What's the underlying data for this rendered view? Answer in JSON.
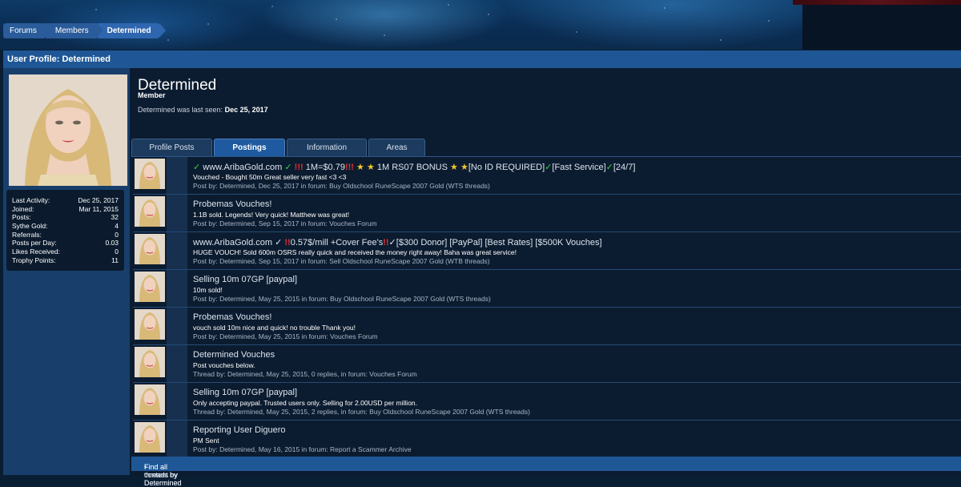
{
  "breadcrumb": [
    "Forums",
    "Members",
    "Determined"
  ],
  "header": {
    "title": "User Profile: Determined"
  },
  "profile": {
    "username": "Determined",
    "role": "Member",
    "last_seen_label": "Determined was last seen:",
    "last_seen_value": "Dec 25, 2017"
  },
  "stats": [
    {
      "label": "Last Activity:",
      "value": "Dec 25, 2017"
    },
    {
      "label": "Joined:",
      "value": "Mar 11, 2015"
    },
    {
      "label": "Posts:",
      "value": "32"
    },
    {
      "label": "Sythe Gold:",
      "value": "4"
    },
    {
      "label": "Referrals:",
      "value": "0"
    },
    {
      "label": "Posts per Day:",
      "value": "0.03"
    },
    {
      "label": "Likes Received:",
      "value": "0"
    },
    {
      "label": "Trophy Points:",
      "value": "11"
    }
  ],
  "tabs": [
    {
      "label": "Profile Posts",
      "active": false
    },
    {
      "label": "Postings",
      "active": true
    },
    {
      "label": "Information",
      "active": false
    },
    {
      "label": "Areas",
      "active": false
    }
  ],
  "posts": [
    {
      "title_parts": {
        "p1": "www.AribaGold.com",
        "p2": "1M=$0.79",
        "p3": "1M RS07 BONUS",
        "p4": "[No ID REQUIRED]",
        "p5": "[Fast Service]",
        "p6": "[24/7]"
      },
      "snippet": "Vouched - Bought 50m Great seller very fast <3 <3",
      "meta": "Post by: Determined, Dec 25, 2017 in forum: Buy Oldschool RuneScape 2007 Gold (WTS threads)"
    },
    {
      "title": "Probemas Vouches!",
      "snippet": "1.1B sold. Legends! Very quick! Matthew was great!",
      "meta": "Post by: Determined, Sep 15, 2017 in forum: Vouches Forum"
    },
    {
      "title_parts": {
        "p1": "www.AribaGold.com ✓",
        "p2": "0.57$/mill +Cover Fee's",
        "p3": "✓[$300 Donor] [PayPal] [Best Rates] [$500K Vouches]"
      },
      "snippet": "HUGE VOUCH! Sold 600m OSRS really quick and received the money right away! Baha was great service!",
      "meta": "Post by: Determined, Sep 15, 2017 in forum: Sell Oldschool RuneScape 2007 Gold (WTB threads)"
    },
    {
      "title": "Selling 10m 07GP [paypal]",
      "snippet": "10m sold!",
      "meta": "Post by: Determined, May 25, 2015 in forum: Buy Oldschool RuneScape 2007 Gold (WTS threads)"
    },
    {
      "title": "Probemas Vouches!",
      "snippet": "vouch sold 10m nice and quick! no trouble Thank you!",
      "meta": "Post by: Determined, May 25, 2015 in forum: Vouches Forum"
    },
    {
      "title": "Determined Vouches",
      "snippet": "Post vouches below.",
      "meta": "Thread by: Determined, May 25, 2015, 0 replies, in forum: Vouches Forum"
    },
    {
      "title": "Selling 10m 07GP [paypal]",
      "snippet": "Only accepting paypal. Trusted users only. Selling for 2.00USD per million.",
      "meta": "Thread by: Determined, May 25, 2015, 2 replies, in forum: Buy Oldschool RuneScape 2007 Gold (WTS threads)"
    },
    {
      "title": "Reporting User Diguero",
      "snippet": "PM Sent",
      "meta": "Post by: Determined, May 16, 2015 in forum: Report a Scammer Archive"
    }
  ],
  "footer": {
    "find_content": "Find all content by Determined",
    "separator": " • ",
    "find_threads": "Find all threads by Determined"
  },
  "glyphs": {
    "check": "✓",
    "bang": "!!!",
    "double_bang": "!!",
    "star": "★"
  },
  "colors": {
    "accent": "#1f5796",
    "check": "#3bd04a",
    "alert": "#e23030",
    "star": "#f3c624"
  }
}
